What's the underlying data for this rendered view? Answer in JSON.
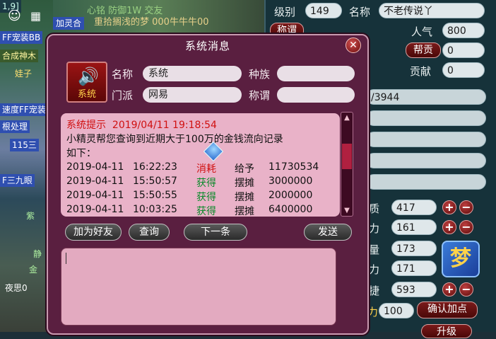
{
  "background": {
    "left_chips": [
      "1,9]",
      "FF宠装BB",
      "合成神木",
      "娃子",
      "速度FF宠装",
      "根处理",
      "115三",
      "F三九眼",
      "紫",
      "静",
      "金",
      "夜思0"
    ],
    "left_icons": [
      "avatar-icon",
      "calendar-icon"
    ],
    "top_chip": "加灵合",
    "scroll_text_1": "心铭 防御1W   交友",
    "scroll_text_2": "重拾搁浅的梦 000牛牛牛00"
  },
  "character_panel": {
    "level_label": "级别",
    "level_value": "149",
    "name_label": "名称",
    "name_value": "不老传说丫",
    "title_button": "称谓",
    "popularity_label": "人气",
    "popularity_value": "800",
    "guild_button": "帮贡",
    "guild_value": "0",
    "contribution_label": "贡献",
    "contribution_value": "0",
    "hp_value": "/3944",
    "stats": [
      {
        "label": "质",
        "value": "417"
      },
      {
        "label": "力",
        "value": "161"
      },
      {
        "label": "量",
        "value": "173"
      },
      {
        "label": "力",
        "value": "171"
      },
      {
        "label": "捷",
        "value": "593"
      }
    ],
    "remain_label": "力",
    "remain_value": "100",
    "confirm_button": "确认加点",
    "bottom_button": "升级"
  },
  "dialog": {
    "title": "系统消息",
    "icon_label": "系统",
    "name_label": "名称",
    "name_value": "系统",
    "race_label": "种族",
    "race_value": "",
    "faction_label": "门派",
    "faction_value": "网易",
    "title_label": "称谓",
    "title_value": "",
    "message": {
      "header_prefix": "系统提示",
      "header_datetime": "2019/04/11 19:18:54",
      "line1": "小精灵帮您查询到近期大于100万的金钱流向记录",
      "line2": "如下：",
      "records": [
        {
          "date": "2019-04-11",
          "time": "16:22:23",
          "type": "消耗",
          "action": "给予",
          "amount": "11730534"
        },
        {
          "date": "2019-04-11",
          "time": "15:50:57",
          "type": "获得",
          "action": "摆摊",
          "amount": "3000000"
        },
        {
          "date": "2019-04-11",
          "time": "15:50:55",
          "type": "获得",
          "action": "摆摊",
          "amount": "2000000"
        },
        {
          "date": "2019-04-11",
          "time": "10:03:25",
          "type": "获得",
          "action": "摆摊",
          "amount": "6400000"
        }
      ]
    },
    "buttons": {
      "add_friend": "加为好友",
      "query": "查询",
      "next": "下一条",
      "send": "发送"
    },
    "colors": {
      "spend": "#d01010",
      "gain": "#0a8a2a",
      "header": "#d01010"
    }
  }
}
